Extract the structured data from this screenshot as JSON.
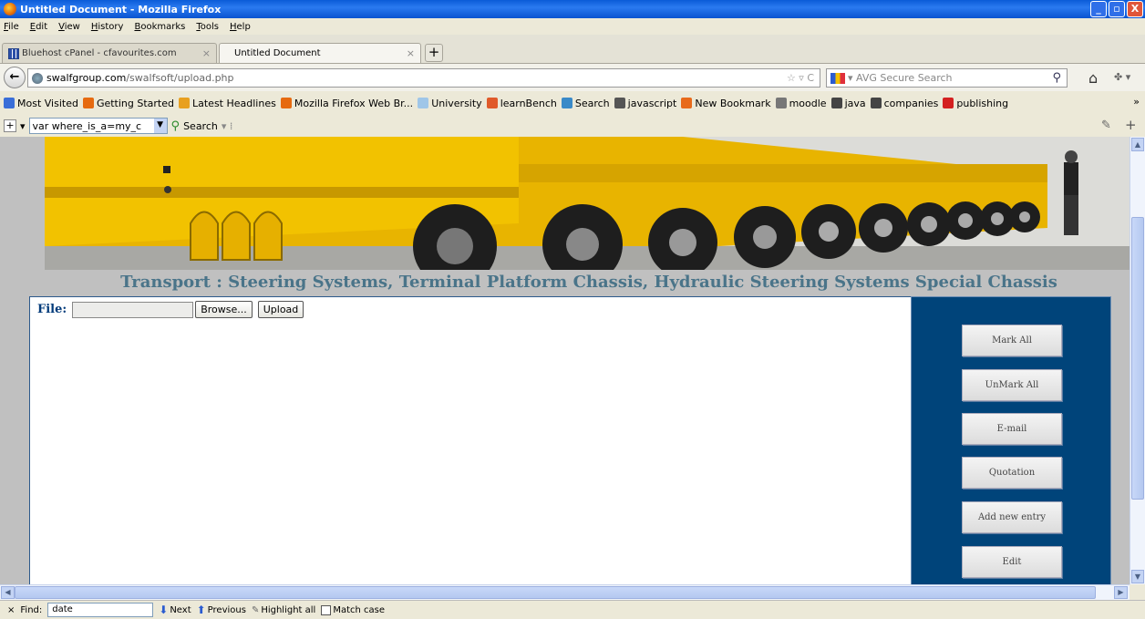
{
  "window": {
    "title": "Untitled Document - Mozilla Firefox",
    "min": "_",
    "max": "▫",
    "close": "X"
  },
  "menu": [
    "File",
    "Edit",
    "View",
    "History",
    "Bookmarks",
    "Tools",
    "Help"
  ],
  "tabs": [
    {
      "label": "Bluehost cPanel - cfavourites.com",
      "close": "×"
    },
    {
      "label": "Untitled Document",
      "close": "×"
    }
  ],
  "newtab_label": "+",
  "nav": {
    "back": "←",
    "url_host": "swalfgroup.com",
    "url_path": "/swalfsoft/upload.php",
    "url_tools": "☆ ▿ C",
    "search_placeholder": "▾ AVG Secure Search",
    "home": "⌂",
    "extra": "✤ ▾"
  },
  "bookmarks": [
    {
      "label": "Most Visited",
      "color": "#3a6ed8"
    },
    {
      "label": "Getting Started",
      "color": "#e66a10"
    },
    {
      "label": "Latest Headlines",
      "color": "#e8a020"
    },
    {
      "label": "Mozilla Firefox Web Br...",
      "color": "#e66a10"
    },
    {
      "label": "University",
      "color": "#9fc6e8"
    },
    {
      "label": "learnBench",
      "color": "#e05a2a"
    },
    {
      "label": "Search",
      "color": "#3a8ac8"
    },
    {
      "label": "javascript",
      "color": "#555555"
    },
    {
      "label": "New Bookmark",
      "color": "#e86a1a"
    },
    {
      "label": "moodle",
      "color": "#777777"
    },
    {
      "label": "java",
      "color": "#444444"
    },
    {
      "label": "companies",
      "color": "#444444"
    },
    {
      "label": "publishing",
      "color": "#d42020"
    }
  ],
  "bookmarks_more": "»",
  "toolbar": {
    "add": "+",
    "dropdown_arrow": "▾",
    "combo_value": "var where_is_a=my_c",
    "search_label": "Search",
    "search_arrow": "▾ ⁞",
    "wrench": "✎",
    "plus": "+"
  },
  "page": {
    "banner_title": "Transport : Steering Systems, Terminal Platform Chassis, Hydraulic Steering Systems Special Chassis",
    "file_label": "File:",
    "browse_label": "Browse...",
    "upload_label": "Upload",
    "side_buttons": [
      "Mark All",
      "UnMark All",
      "E-mail",
      "Quotation",
      "Add new entry",
      "Edit"
    ]
  },
  "findbar": {
    "close": "×",
    "label": "Find:",
    "value": "date",
    "next": "Next",
    "previous": "Previous",
    "highlight": "Highlight all",
    "match_case": "Match case"
  },
  "colors": {
    "banner_title": "#4a7489",
    "side_panel": "#00447a",
    "file_label": "#003a7a"
  }
}
